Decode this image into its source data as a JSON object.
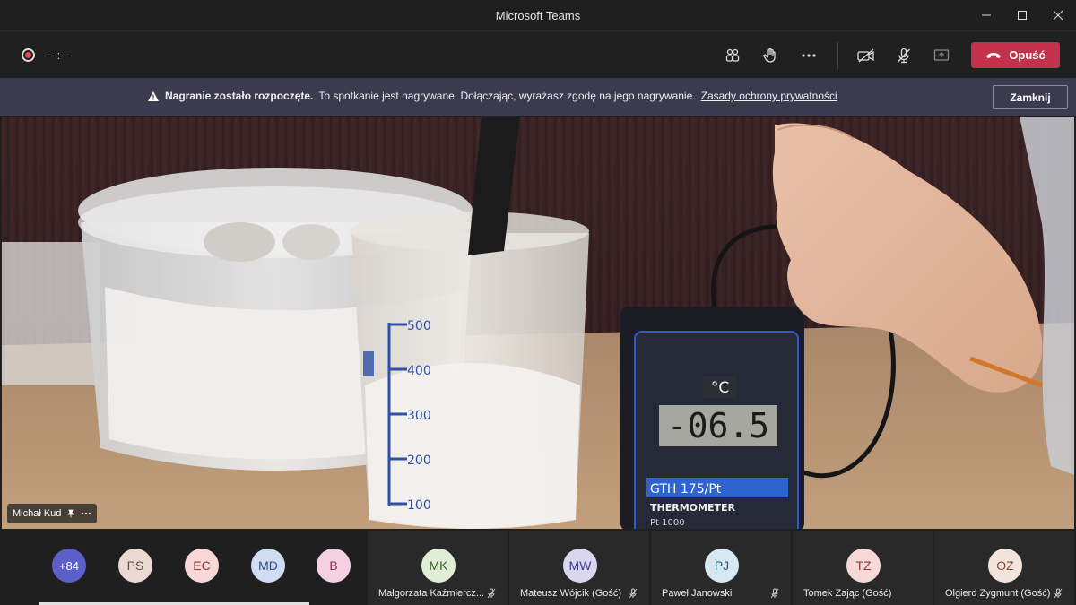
{
  "window": {
    "title": "Microsoft Teams"
  },
  "toolbar": {
    "timer": "--:--",
    "leave_label": "Opuść"
  },
  "banner": {
    "title": "Nagranie zostało rozpoczęte.",
    "text": "To spotkanie jest nagrywane. Dołączając, wyrażasz zgodę na jego nagrywanie.",
    "link": "Zasady ochrony prywatności",
    "close_label": "Zamknij"
  },
  "video": {
    "presenter_name": "Michał Kud",
    "display_unit": "°C",
    "display_value": "-06.5",
    "device_model": "GTH 175/Pt",
    "device_label": "THERMOMETER",
    "device_sub": "Pt 1000",
    "beaker_marks": [
      "500",
      "400",
      "300",
      "200",
      "100"
    ]
  },
  "participants": {
    "overflow": {
      "initials": "+84",
      "color": "#5b5fc7"
    },
    "small": [
      {
        "initials": "PS",
        "color": "#ead9d3"
      },
      {
        "initials": "EC",
        "color": "#f6d8d6"
      },
      {
        "initials": "MD",
        "color": "#cfdcf2"
      },
      {
        "initials": "B",
        "color": "#f5d0e0"
      }
    ],
    "tiles": [
      {
        "initials": "MK",
        "name": "Małgorzata Kaźmiercz...",
        "color": "#dfeed5"
      },
      {
        "initials": "MW",
        "name": "Mateusz Wójcik (Gość)",
        "color": "#d9d6f0"
      },
      {
        "initials": "PJ",
        "name": "Paweł Janowski",
        "color": "#d6e8f2"
      },
      {
        "initials": "TZ",
        "name": "Tomek Zając (Gość)",
        "color": "#f6d8d6"
      },
      {
        "initials": "OZ",
        "name": "Olgierd Zygmunt (Gość)",
        "color": "#f3e4dc"
      }
    ]
  }
}
